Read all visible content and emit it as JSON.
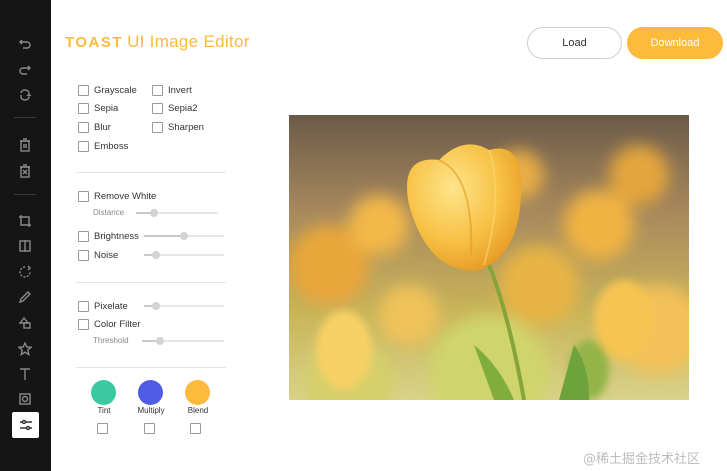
{
  "header": {
    "logo_brand": "TOAST",
    "logo_product": "UI Image Editor",
    "load_label": "Load",
    "download_label": "Download"
  },
  "toolbar": {
    "tools": [
      {
        "icon": "undo-icon"
      },
      {
        "icon": "redo-icon"
      },
      {
        "icon": "reset-icon"
      },
      {
        "icon": "delete-icon"
      },
      {
        "icon": "delete-all-icon"
      },
      {
        "icon": "crop-icon"
      },
      {
        "icon": "flip-icon"
      },
      {
        "icon": "rotate-icon"
      },
      {
        "icon": "draw-icon"
      },
      {
        "icon": "shape-icon"
      },
      {
        "icon": "icon-tool-icon"
      },
      {
        "icon": "text-icon"
      },
      {
        "icon": "mask-icon"
      },
      {
        "icon": "filter-icon",
        "active": true
      }
    ]
  },
  "filters": {
    "grayscale": "Grayscale",
    "invert": "Invert",
    "sepia": "Sepia",
    "sepia2": "Sepia2",
    "blur": "Blur",
    "sharpen": "Sharpen",
    "emboss": "Emboss",
    "remove_white": "Remove White",
    "distance": "Distance",
    "brightness": "Brightness",
    "noise": "Noise",
    "pixelate": "Pixelate",
    "color_filter": "Color Filter",
    "threshold": "Threshold",
    "tint": "Tint",
    "multiply": "Multiply",
    "blend": "Blend"
  },
  "colors": {
    "accent": "#fdba3b",
    "tint": "#3bc9a0",
    "multiply": "#515ce6",
    "blend": "#fdba3b"
  },
  "watermark": "@稀土掘金技术社区"
}
